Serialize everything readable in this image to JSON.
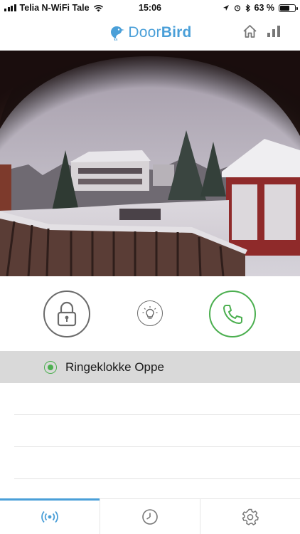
{
  "status_bar": {
    "carrier": "Telia N-WiFi Tale",
    "time": "15:06",
    "battery_percent": "63 %",
    "battery_level": 0.63
  },
  "header": {
    "logo_part1": "Door",
    "logo_part2": "Bird",
    "brand_color": "#4a9fd8",
    "icons": [
      "home-icon",
      "signal-bars-icon"
    ]
  },
  "actions": {
    "lock_icon": "padlock-icon",
    "light_icon": "light-bulb-icon",
    "call_icon": "phone-icon",
    "call_color": "#4caf50"
  },
  "device": {
    "name": "Ringeklokke Oppe",
    "selected": true
  },
  "tabs": [
    {
      "icon": "live-broadcast-icon",
      "active": true
    },
    {
      "icon": "clock-history-icon",
      "active": false
    },
    {
      "icon": "settings-gear-icon",
      "active": false
    }
  ]
}
